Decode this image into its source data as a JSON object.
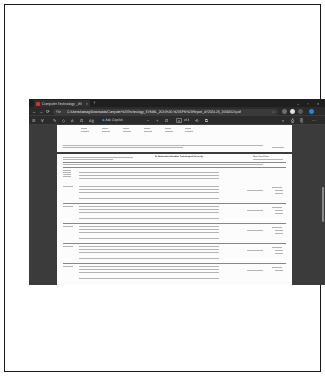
{
  "browser": {
    "tab_title": "Computer Technology _WIPPA...",
    "tab_close": "×",
    "new_tab": "+",
    "window_controls": [
      "–",
      "▫",
      "×"
    ]
  },
  "address_bar": {
    "back": "←",
    "forward": "→",
    "reload": "⟳",
    "scheme_label": "File",
    "url": "C:/Users/kamag/Downloads/Computer%20Technology_EVMML_2024%20-%20SPN%20Report_AY2024-25_20062024.pdf",
    "bookmark": "☆"
  },
  "pdf_toolbar": {
    "contents": "☰",
    "draw": "∀",
    "highlight": "✎",
    "erase": "◇",
    "text": "A",
    "page_view": "⊡",
    "read_aloud": "A))",
    "ask_copilot": "Ask Copilot",
    "zoom_out": "−",
    "zoom_in": "+",
    "fit": "⊡",
    "page_current": "3",
    "page_total": "of 4",
    "rotate": "⟲",
    "two_page": "⧉",
    "search": "⌕",
    "save": "⎙",
    "print": "⎘",
    "more": "⋯"
  },
  "document": {
    "report_title": "Dr. Babasaheb Ambedkar Technological University",
    "section_heading": "Winter Result Sheet"
  },
  "colors": {
    "browser_bg": "#2b2b2b",
    "tabstrip_bg": "#1f1f1f",
    "pdf_red": "#d93025",
    "copilot": "#3b82f6"
  }
}
